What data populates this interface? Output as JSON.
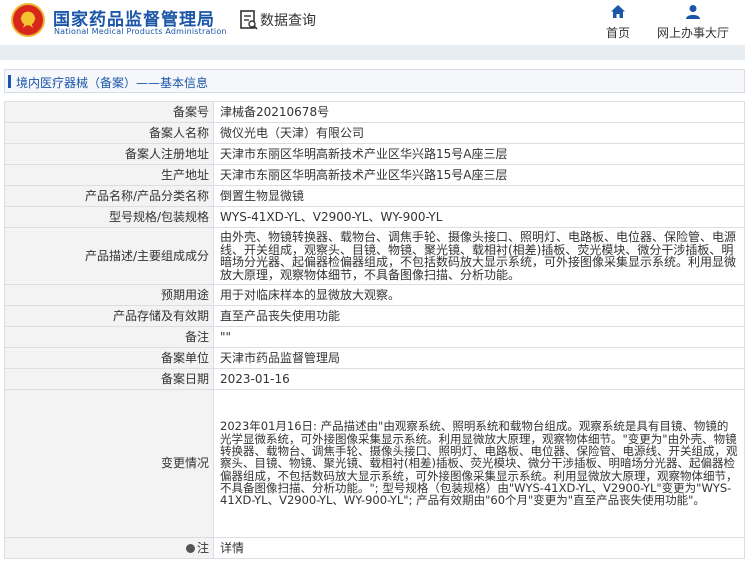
{
  "header": {
    "brand_cn": "国家药品监督管理局",
    "brand_en": "National Medical Products Administration",
    "query_title": "数据查询",
    "nav": [
      {
        "label": "首页",
        "icon": "home-icon"
      },
      {
        "label": "网上办事大厅",
        "icon": "user-icon"
      }
    ]
  },
  "colors": {
    "brand_blue": "#1b56a8",
    "key_bg": "#f3f3f3",
    "border": "#d9dfe6"
  },
  "breadcrumb": "境内医疗器械（备案）——基本信息",
  "record": [
    {
      "label": "备案号",
      "value": "津械备20210678号"
    },
    {
      "label": "备案人名称",
      "value": "微仪光电（天津）有限公司"
    },
    {
      "label": "备案人注册地址",
      "value": "天津市东丽区华明高新技术产业区华兴路15号A座三层"
    },
    {
      "label": "生产地址",
      "value": "天津市东丽区华明高新技术产业区华兴路15号A座三层"
    },
    {
      "label": "产品名称/产品分类名称",
      "value": "倒置生物显微镜"
    },
    {
      "label": "型号规格/包装规格",
      "value": "WYS-41XD-YL、V2900-YL、WY-900-YL"
    },
    {
      "label": "产品描述/主要组成成分",
      "value": "由外壳、物镜转换器、载物台、调焦手轮、摄像头接口、照明灯、电路板、电位器、保险管、电源线、开关组成，观察头、目镜、物镜、聚光镜、载相衬(相差)插板、荧光模块、微分干涉插板、明暗场分光器、起偏器检偏器组成，不包括数码放大显示系统，可外接图像采集显示系统。利用显微放大原理，观察物体细节，不具备图像扫描、分析功能。"
    },
    {
      "label": "预期用途",
      "value": "用于对临床样本的显微放大观察。"
    },
    {
      "label": "产品存储及有效期",
      "value": "直至产品丧失使用功能"
    },
    {
      "label": "备注",
      "value": "\"\""
    },
    {
      "label": "备案单位",
      "value": "天津市药品监督管理局"
    },
    {
      "label": "备案日期",
      "value": "2023-01-16"
    },
    {
      "label": "变更情况",
      "value": "2023年01月16日: 产品描述由\"由观察系统、照明系统和载物台组成。观察系统是具有目镜、物镜的光学显微系统，可外接图像采集显示系统。利用显微放大原理，观察物体细节。\"变更为\"由外壳、物镜转换器、载物台、调焦手轮、摄像头接口、照明灯、电路板、电位器、保险管、电源线、开关组成，观察头、目镜、物镜、聚光镜、载相衬(相差)插板、荧光模块、微分干涉插板、明暗场分光器、起偏器检偏器组成，不包括数码放大显示系统，可外接图像采集显示系统。利用显微放大原理，观察物体细节，不具备图像扫描、分析功能。\"; 型号规格（包装规格）由\"WYS-41XD-YL、V2900-YL\"变更为\"WYS-41XD-YL、V2900-YL、WY-900-YL\"; 产品有效期由\"60个月\"变更为\"直至产品丧失使用功能\"。"
    },
    {
      "label": "注",
      "value": "详情",
      "icon": "info-icon"
    }
  ]
}
